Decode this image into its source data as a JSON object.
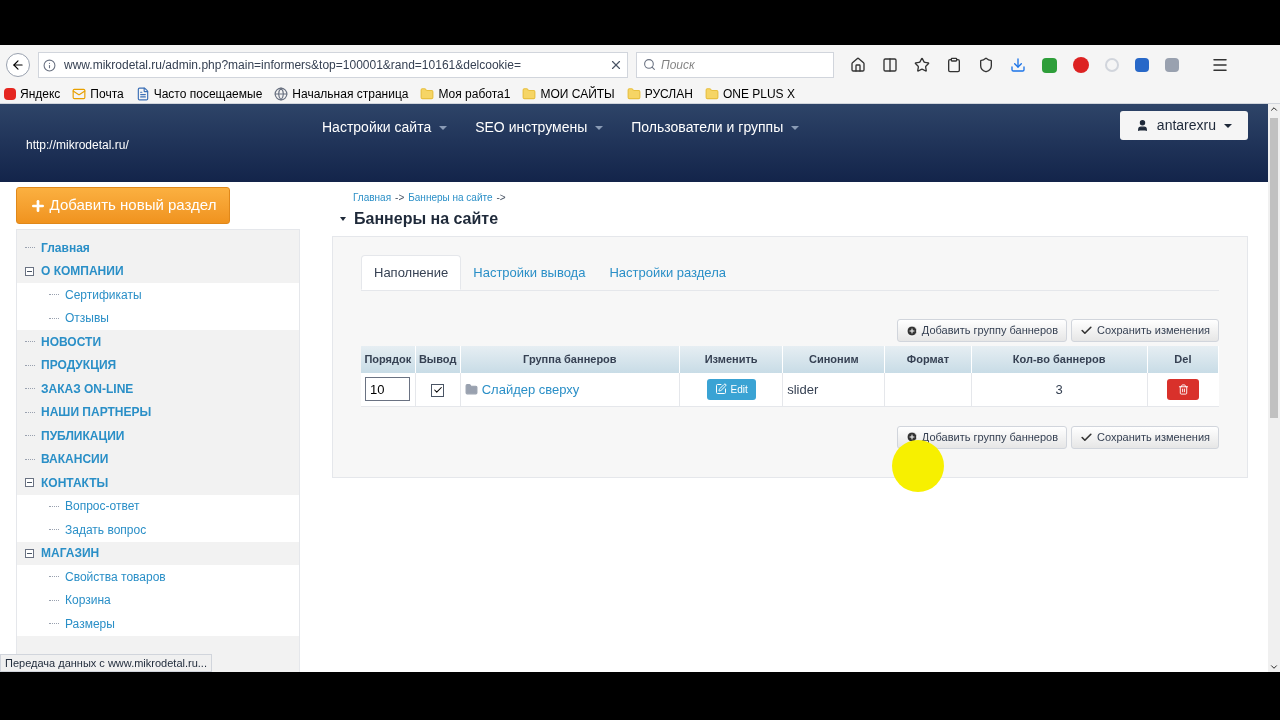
{
  "browser": {
    "url": "www.mikrodetal.ru/admin.php?main=informers&top=100001&rand=10161&delcookie=",
    "search_placeholder": "Поиск",
    "bookmarks": [
      {
        "label": "Яндекс",
        "kind": "yandex"
      },
      {
        "label": "Почта",
        "kind": "mail"
      },
      {
        "label": "Часто посещаемые",
        "kind": "page"
      },
      {
        "label": "Начальная страница",
        "kind": "globe"
      },
      {
        "label": "Моя работа1",
        "kind": "folder"
      },
      {
        "label": "МОИ САЙТЫ",
        "kind": "folder"
      },
      {
        "label": "РУСЛАН",
        "kind": "folder"
      },
      {
        "label": "ONE PLUS X",
        "kind": "folder"
      }
    ],
    "status": "Передача данных с www.mikrodetal.ru..."
  },
  "header": {
    "site": "http://mikrodetal.ru/",
    "menu": [
      "Настройки сайта",
      "SEO инструмены",
      "Пользователи и группы"
    ],
    "user": "antarexru"
  },
  "add_section_button": "Добавить новый раздел",
  "tree": [
    {
      "label": "Главная"
    },
    {
      "label": "О КОМПАНИИ",
      "expanded": true,
      "children": [
        {
          "label": "Сертификаты"
        },
        {
          "label": "Отзывы"
        }
      ]
    },
    {
      "label": "НОВОСТИ"
    },
    {
      "label": "ПРОДУКЦИЯ"
    },
    {
      "label": "ЗАКАЗ ON-LINE"
    },
    {
      "label": "НАШИ ПАРТНЕРЫ"
    },
    {
      "label": "ПУБЛИКАЦИИ"
    },
    {
      "label": "ВАКАНСИИ"
    },
    {
      "label": "КОНТАКТЫ",
      "expanded": true,
      "children": [
        {
          "label": "Вопрос-ответ"
        },
        {
          "label": "Задать вопрос"
        }
      ]
    },
    {
      "label": "МАГАЗИН",
      "expanded": true,
      "children": [
        {
          "label": "Свойства товаров"
        },
        {
          "label": "Корзина"
        },
        {
          "label": "Размеры"
        }
      ]
    }
  ],
  "breadcrumbs": [
    "Главная",
    "Баннеры на сайте"
  ],
  "breadcrumb_separator": "->",
  "title": "Баннеры на сайте",
  "tabs": [
    {
      "label": "Наполнение",
      "selected": true
    },
    {
      "label": "Настройки вывода",
      "selected": false
    },
    {
      "label": "Настройки раздела",
      "selected": false
    }
  ],
  "action_bars": [
    {
      "add": "Добавить группу баннеров",
      "save": "Сохранить изменения"
    },
    {
      "add": "Добавить группу баннеров",
      "save": "Сохранить изменения"
    }
  ],
  "table": {
    "columns": [
      "Порядок",
      "Вывод",
      "Группа баннеров",
      "Изменить",
      "Синоним",
      "Формат",
      "Кол-во баннеров",
      "Del"
    ],
    "rows": [
      {
        "order": "10",
        "visible": true,
        "group": "Слайдер сверху",
        "edit": "Edit",
        "alias": "slider",
        "count": "3"
      }
    ]
  }
}
